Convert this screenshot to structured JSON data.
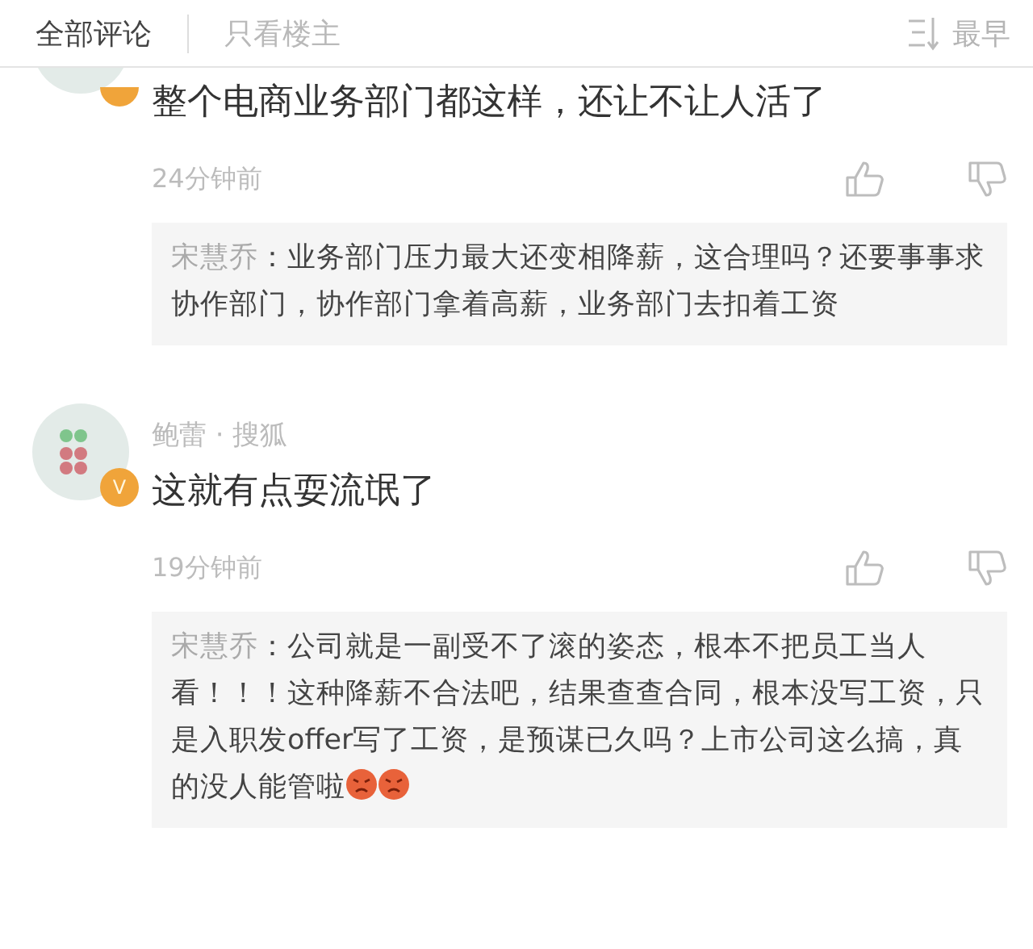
{
  "tabs": [
    {
      "label": "全部评论",
      "selected": true
    },
    {
      "label": "只看楼主",
      "selected": false
    }
  ],
  "sort": {
    "label": "最早"
  },
  "comments": [
    {
      "verified": true,
      "text": "整个电商业务部门都这样，还让不让人活了",
      "time": "24分钟前",
      "reply": {
        "author": "宋慧乔",
        "text": "：业务部门压力最大还变相降薪，这合理吗？还要事事求协作部门，协作部门拿着高薪，业务部门去扣着工资"
      }
    },
    {
      "verified": true,
      "badge_text": "V",
      "author": "鲍蕾 · 搜狐",
      "text": "这就有点耍流氓了",
      "time": "19分钟前",
      "reply": {
        "author": "宋慧乔",
        "text": "：公司就是一副受不了滚的姿态，根本不把员工当人看！！！这种降薪不合法吧，结果查查合同，根本没写工资，只是入职发offer写了工资，是预谋已久吗？上市公司这么搞，真的没人能管啦",
        "emojis": [
          {
            "kind": "angry"
          },
          {
            "kind": "angry"
          }
        ]
      }
    }
  ]
}
